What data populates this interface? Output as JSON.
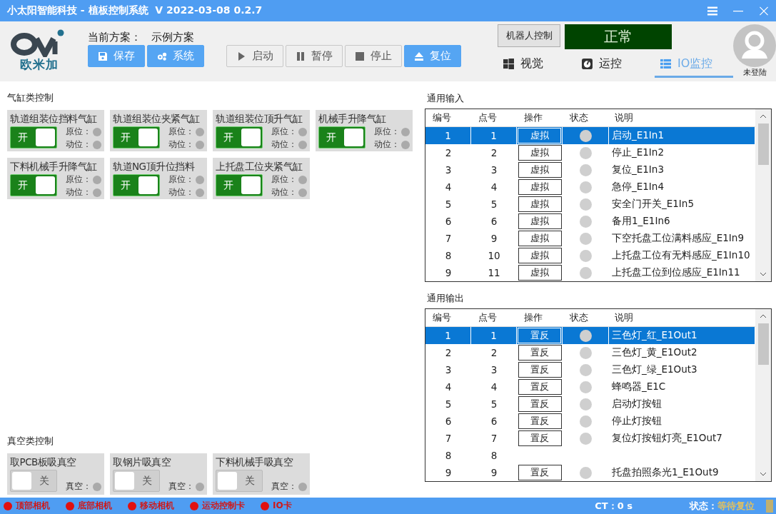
{
  "window": {
    "title": "小太阳智能科技 - 植板控制系统  V 2022-03-08 0.2.7"
  },
  "header": {
    "logo_text": "欧米加",
    "scheme_label": "当前方案：",
    "scheme_value": "示例方案",
    "buttons": [
      {
        "label": "保存",
        "kind": "primary"
      },
      {
        "label": "系统",
        "kind": "primary"
      },
      {
        "label": "启动",
        "kind": "plain"
      },
      {
        "label": "暂停",
        "kind": "plain"
      },
      {
        "label": "停止",
        "kind": "plain"
      },
      {
        "label": "复位",
        "kind": "primary"
      }
    ],
    "robot_button": "机器人控制",
    "status_display": "正常",
    "tabs": [
      {
        "label": "视觉",
        "selected": false
      },
      {
        "label": "运控",
        "selected": false
      },
      {
        "label": "IO监控",
        "selected": true
      }
    ],
    "user": {
      "label": "未登陆"
    }
  },
  "cylinders": {
    "title": "气缸类控制",
    "items": [
      {
        "name": "轨道组装位挡料气缸",
        "on": true,
        "switch_label": "开",
        "home_label": "原位：",
        "work_label": "动位："
      },
      {
        "name": "轨道组装位夹紧气缸",
        "on": true,
        "switch_label": "开",
        "home_label": "原位：",
        "work_label": "动位："
      },
      {
        "name": "轨道组装位顶升气缸",
        "on": true,
        "switch_label": "开",
        "home_label": "原位：",
        "work_label": "动位："
      },
      {
        "name": "机械手升降气缸",
        "on": true,
        "switch_label": "开",
        "home_label": "原位：",
        "work_label": "动位："
      },
      {
        "name": "下料机械手升降气缸",
        "on": true,
        "switch_label": "开",
        "home_label": "原位：",
        "work_label": "动位："
      },
      {
        "name": "轨道NG顶升位挡料",
        "on": true,
        "switch_label": "开",
        "home_label": "原位：",
        "work_label": "动位："
      },
      {
        "name": "上托盘工位夹紧气缸",
        "on": true,
        "switch_label": "开",
        "home_label": "原位：",
        "work_label": "动位："
      }
    ]
  },
  "vacuum": {
    "title": "真空类控制",
    "items": [
      {
        "name": "取PCB板吸真空",
        "on": false,
        "switch_label": "关",
        "vacuum_label": "真空："
      },
      {
        "name": "取钢片吸真空",
        "on": false,
        "switch_label": "关",
        "vacuum_label": "真空："
      },
      {
        "name": "下料机械手吸真空",
        "on": false,
        "switch_label": "关",
        "vacuum_label": "真空："
      }
    ]
  },
  "inputs": {
    "title": "通用输入",
    "columns": [
      "编号",
      "点号",
      "操作",
      "状态",
      "说明"
    ],
    "rows": [
      {
        "no": "1",
        "point": "1",
        "op": "虚拟",
        "desc": "启动_E1In1",
        "selected": true
      },
      {
        "no": "2",
        "point": "2",
        "op": "虚拟",
        "desc": "停止_E1In2",
        "selected": false
      },
      {
        "no": "3",
        "point": "3",
        "op": "虚拟",
        "desc": "复位_E1In3",
        "selected": false
      },
      {
        "no": "4",
        "point": "4",
        "op": "虚拟",
        "desc": "急停_E1In4",
        "selected": false
      },
      {
        "no": "5",
        "point": "5",
        "op": "虚拟",
        "desc": "安全门开关_E1In5",
        "selected": false
      },
      {
        "no": "6",
        "point": "6",
        "op": "虚拟",
        "desc": "备用1_E1In6",
        "selected": false
      },
      {
        "no": "7",
        "point": "9",
        "op": "虚拟",
        "desc": "下空托盘工位满料感应_E1In9",
        "selected": false
      },
      {
        "no": "8",
        "point": "10",
        "op": "虚拟",
        "desc": "上托盘工位有无料感应_E1In10",
        "selected": false
      },
      {
        "no": "9",
        "point": "11",
        "op": "虚拟",
        "desc": "上托盘工位到位感应_E1In11",
        "selected": false
      }
    ]
  },
  "outputs": {
    "title": "通用输出",
    "columns": [
      "编号",
      "点号",
      "操作",
      "状态",
      "说明"
    ],
    "rows": [
      {
        "no": "1",
        "point": "1",
        "op": "置反",
        "desc": "三色灯_红_E1Out1",
        "selected": true
      },
      {
        "no": "2",
        "point": "2",
        "op": "置反",
        "desc": "三色灯_黄_E1Out2",
        "selected": false
      },
      {
        "no": "3",
        "point": "3",
        "op": "置反",
        "desc": "三色灯_绿_E1Out3",
        "selected": false
      },
      {
        "no": "4",
        "point": "4",
        "op": "置反",
        "desc": "蜂鸣器_E1C",
        "selected": false
      },
      {
        "no": "5",
        "point": "5",
        "op": "置反",
        "desc": "启动灯按钮",
        "selected": false
      },
      {
        "no": "6",
        "point": "6",
        "op": "置反",
        "desc": "停止灯按钮",
        "selected": false
      },
      {
        "no": "7",
        "point": "7",
        "op": "置反",
        "desc": "复位灯按钮灯亮_E1Out7",
        "selected": false
      },
      {
        "no": "8",
        "point": "8",
        "selected": false
      },
      {
        "no": "9",
        "point": "9",
        "op": "置反",
        "desc": "托盘拍照条光1_E1Out9",
        "selected": false
      }
    ]
  },
  "status_bar": {
    "indicators": [
      "顶部相机",
      "底部相机",
      "移动相机",
      "运动控制卡",
      "IO卡"
    ],
    "ct": "CT：0 s",
    "state_label": "状态：",
    "state_value": "等待复位"
  }
}
